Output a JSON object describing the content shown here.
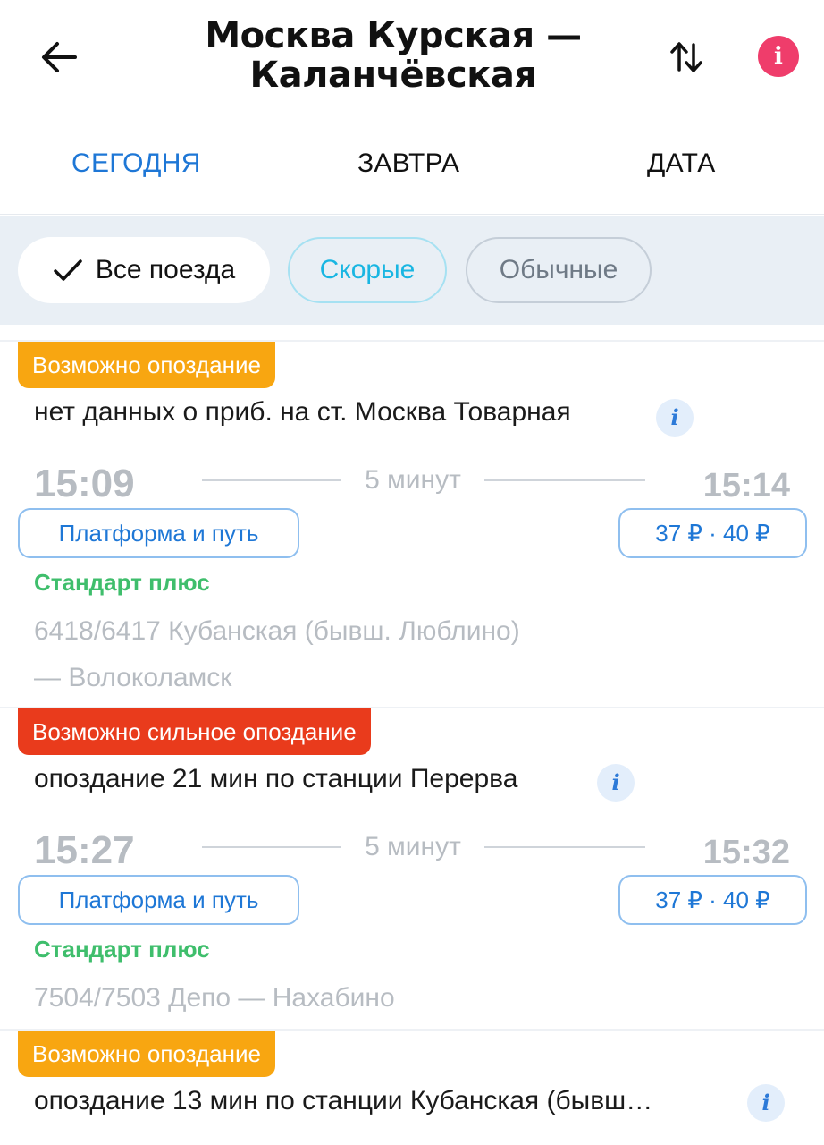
{
  "header": {
    "title_line1": "Москва Курская —",
    "title_line2": "Каланчёвская",
    "icons": {
      "back": "arrow-left-icon",
      "swap": "swap-arrows-icon",
      "info": "info-icon"
    },
    "info_glyph": "i",
    "info_color": "#ef3d6b"
  },
  "tabs": [
    {
      "label": "СЕГОДНЯ",
      "active": true
    },
    {
      "label": "ЗАВТРА",
      "active": false
    },
    {
      "label": "ДАТА",
      "active": false
    }
  ],
  "filters": {
    "all": {
      "label": "Все поезда",
      "selected": true,
      "icon": "check-icon"
    },
    "fast": {
      "label": "Скорые"
    },
    "regular": {
      "label": "Обычные"
    }
  },
  "colors": {
    "accent_blue": "#1e77d6",
    "warning_orange": "#f8a611",
    "danger_red": "#e93b1c",
    "category_green": "#3fbe6c"
  },
  "trains": [
    {
      "badge": "Возможно опоздание",
      "badge_level": "orange",
      "delay_text": "нет данных о приб. на ст. Москва Товарная",
      "info_glyph": "i",
      "departure": "15:09",
      "duration": "5 минут",
      "arrival": "15:14",
      "platform_label": "Платформа и путь",
      "price": "37 ₽ · 40 ₽",
      "category": "Стандарт плюс",
      "route_line1": "6418/6417 Кубанская (бывш. Люблино)",
      "route_line2": "— Волоколамск"
    },
    {
      "badge": "Возможно сильное опоздание",
      "badge_level": "red",
      "delay_text": "опоздание 21 мин по станции Перерва",
      "info_glyph": "i",
      "departure": "15:27",
      "duration": "5 минут",
      "arrival": "15:32",
      "platform_label": "Платформа и путь",
      "price": "37 ₽ · 40 ₽",
      "category": "Стандарт плюс",
      "route_line1": "7504/7503 Депо — Нахабино"
    },
    {
      "badge": "Возможно опоздание",
      "badge_level": "orange",
      "delay_text": "опоздание 13 мин по станции Кубанская (бывш…",
      "info_glyph": "i"
    }
  ]
}
